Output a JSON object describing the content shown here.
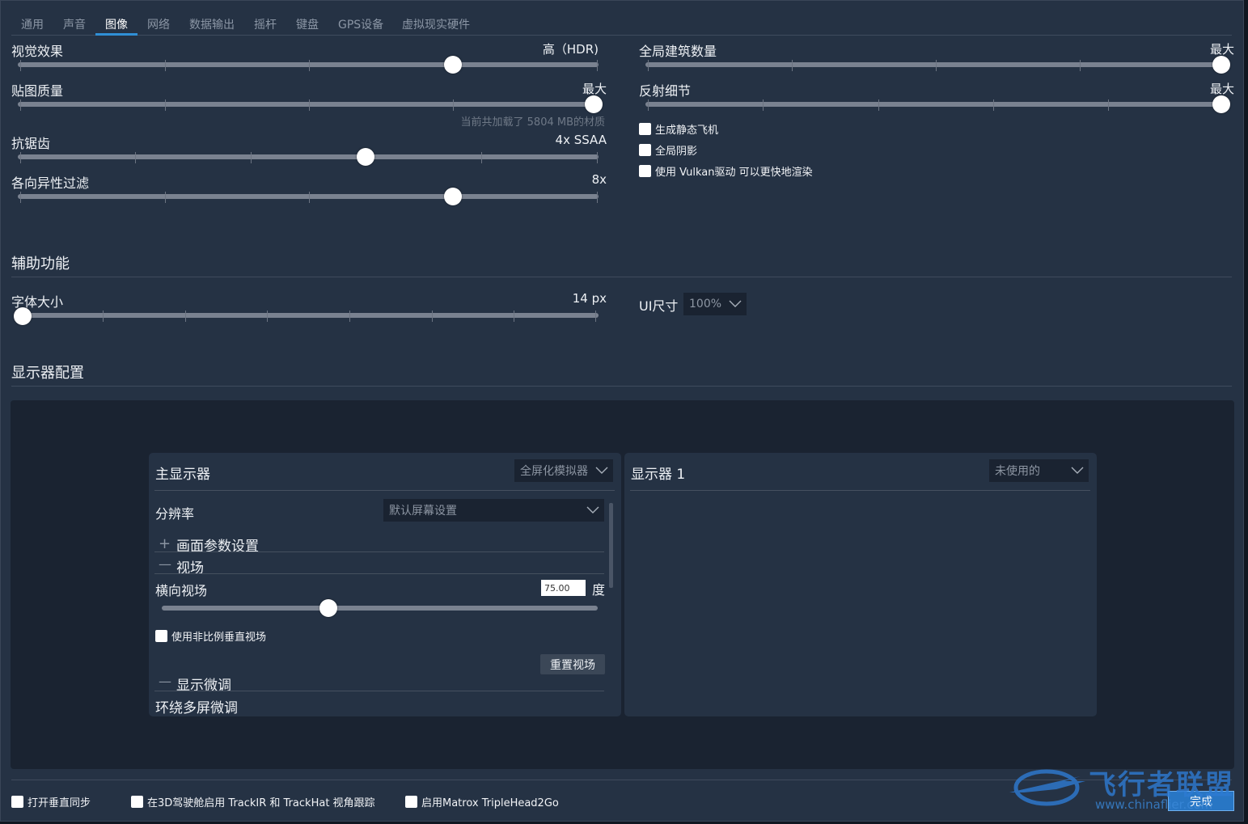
{
  "tabs": [
    "通用",
    "声音",
    "图像",
    "网络",
    "数据输出",
    "摇杆",
    "键盘",
    "GPS设备",
    "虚拟现实硬件"
  ],
  "active_tab": "图像",
  "graphics": {
    "visual_effects": {
      "label": "视觉效果",
      "value": "高（HDR)",
      "level": 0.75
    },
    "texture_quality": {
      "label": "贴图质量",
      "value": "最大",
      "level": 1.0,
      "hint": "当前共加载了 5804 MB的材质"
    },
    "antialiasing": {
      "label": "抗锯齿",
      "value": "4x SSAA",
      "level": 0.6
    },
    "anisotropic": {
      "label": "各向异性过滤",
      "value": "8x",
      "level": 0.75
    },
    "building_count": {
      "label": "全局建筑数量",
      "value": "最大",
      "level": 1.0
    },
    "reflection_detail": {
      "label": "反射细节",
      "value": "最大",
      "level": 1.0
    },
    "checkboxes": [
      "生成静态飞机",
      "全局阴影",
      "使用 Vulkan驱动 可以更快地渲染"
    ]
  },
  "accessibility": {
    "title": "辅助功能",
    "font_size": {
      "label": "字体大小",
      "value": "14 px",
      "level": 0.0
    },
    "ui_size": {
      "label": "UI尺寸",
      "value": "100%"
    }
  },
  "monitors": {
    "title": "显示器配置",
    "main": {
      "title": "主显示器",
      "mode": "全屏化模拟器",
      "resolution_label": "分辨率",
      "resolution_value": "默认屏幕设置",
      "section_params": "画面参数设置",
      "section_fov": "视场",
      "hfov_label": "横向视场",
      "hfov_value": "75.00",
      "hfov_unit": "度",
      "hfov_level": 0.38,
      "nonprop_label": "使用非比例垂直视场",
      "reset_label": "重置视场",
      "section_fine": "显示微调",
      "surround_label": "环绕多屏微调"
    },
    "secondary": {
      "title": "显示器 1",
      "mode": "未使用的"
    }
  },
  "footer": {
    "checkboxes": [
      "打开垂直同步",
      "在3D驾驶舱启用 TrackIR 和 TrackHat 视角跟踪",
      "启用Matrox TripleHead2Go"
    ],
    "done_label": "完成"
  },
  "watermark": {
    "text": "飞行者联盟",
    "url": "www.chinaflier.com"
  }
}
